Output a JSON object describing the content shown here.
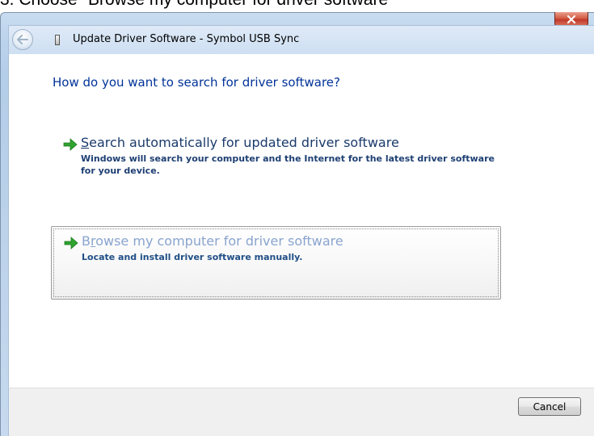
{
  "caption": "3.  Choose \"Browse my computer for driver software\"",
  "window": {
    "title": "Update Driver Software - Symbol USB Sync",
    "question": "How do you want to search for driver software?",
    "options": [
      {
        "title_hotkey": "S",
        "title_rest": "earch automatically for updated driver software",
        "description": "Windows will search your computer and the Internet for the latest driver software for your device."
      },
      {
        "title_prefix": "B",
        "title_hotkey": "r",
        "title_rest": "owse my computer for driver software",
        "description": "Locate and install driver software manually."
      }
    ],
    "cancel_label": "Cancel"
  },
  "colors": {
    "question": "#003399",
    "option_arrow": "#2fa32f",
    "option_highlight_title": "#8aa4cf",
    "close_button": "#c0392b"
  },
  "icons": {
    "close": "close-x-icon",
    "back": "back-arrow-icon",
    "device": "usb-device-icon",
    "option": "green-arrow-icon"
  }
}
